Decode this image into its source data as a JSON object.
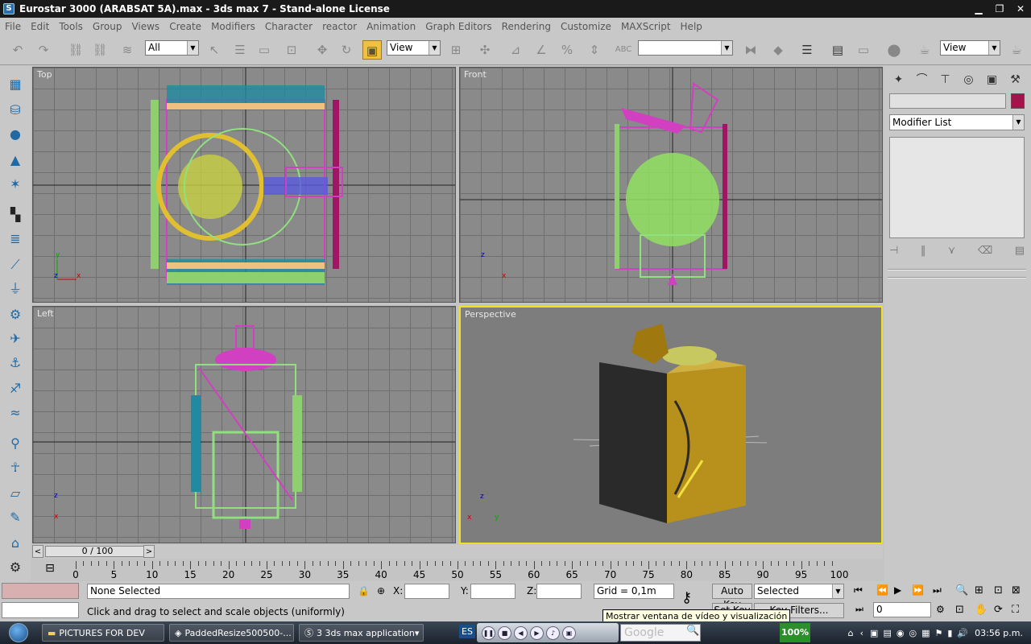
{
  "window": {
    "app_icon": "S",
    "title": "Eurostar 3000 (ARABSAT 5A).max - 3ds max 7  - Stand-alone License",
    "minimize": "▁",
    "maximize": "❐",
    "close": "✕"
  },
  "menu": [
    "File",
    "Edit",
    "Tools",
    "Group",
    "Views",
    "Create",
    "Modifiers",
    "Character",
    "reactor",
    "Animation",
    "Graph Editors",
    "Rendering",
    "Customize",
    "MAXScript",
    "Help"
  ],
  "toolbar": {
    "selection_filter": "All",
    "reference_coord": "View",
    "named_selection": "",
    "render_view": "View"
  },
  "viewports": {
    "top": "Top",
    "front": "Front",
    "left": "Left",
    "perspective": "Perspective",
    "axis_x": "x",
    "axis_y": "y",
    "axis_z": "z"
  },
  "command_panel": {
    "object_name": "",
    "object_color": "#a0164a",
    "modifier_list": "Modifier List"
  },
  "time_slider": {
    "frame_display": "0 / 100",
    "prev": "<",
    "next": ">"
  },
  "trackbar": {
    "ticks": [
      "0",
      "5",
      "10",
      "15",
      "20",
      "25",
      "30",
      "35",
      "40",
      "45",
      "50",
      "55",
      "60",
      "65",
      "70",
      "75",
      "80",
      "85",
      "90",
      "95",
      "100"
    ]
  },
  "status": {
    "selection": "None Selected",
    "prompt": "Click and drag to select and scale objects (uniformly)",
    "x_label": "X:",
    "y_label": "Y:",
    "z_label": "Z:",
    "x_value": "",
    "y_value": "",
    "z_value": "",
    "grid": "Grid = 0,1m",
    "auto_key": "Auto Key",
    "set_key_dropdown": "Selected",
    "set_key": "Set Key",
    "key_filters": "Key Filters...",
    "current_frame": "0"
  },
  "tooltip": "Mostrar ventana de vídeo y visualización",
  "taskbar": {
    "items": [
      "PICTURES FOR DEV",
      "PaddedResize500500-...",
      "3  3ds max application"
    ],
    "lang": "ES",
    "search_placeholder": "Google",
    "zoom": "100%",
    "clock": "03:56 p.m."
  }
}
